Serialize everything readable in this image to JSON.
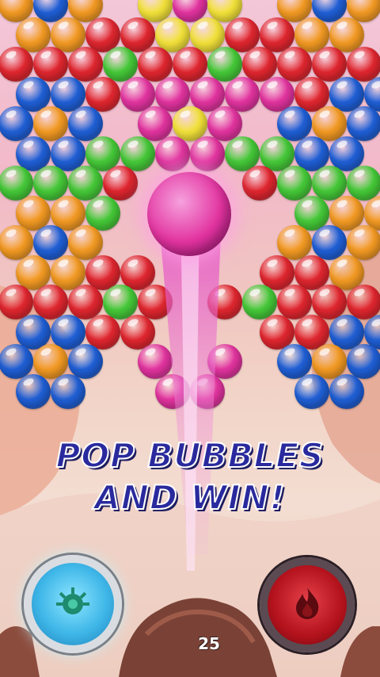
{
  "promo": {
    "line1": "POP BUBBLES",
    "line2": "AND WIN!"
  },
  "counter": {
    "shots_left": "25"
  },
  "buttons": {
    "booster": {
      "icon": "gear-bomb-icon",
      "color": "#3fb7e8"
    },
    "fire": {
      "icon": "flame-icon",
      "color": "#c21822"
    }
  },
  "shot_bubble": {
    "color": "magenta"
  },
  "palette": {
    "red": "#e0262f",
    "orange": "#f39a23",
    "blue": "#1f5fd6",
    "green": "#45c938",
    "yellow": "#f3e23a",
    "magenta": "#e2339f"
  },
  "grid": [
    [
      "orange",
      "blue",
      "orange",
      "",
      "yellow",
      "magenta",
      "yellow",
      "",
      "orange",
      "blue",
      "orange"
    ],
    [
      "orange",
      "orange",
      "red",
      "red",
      "yellow",
      "yellow",
      "red",
      "red",
      "orange",
      "orange",
      ""
    ],
    [
      "red",
      "red",
      "red",
      "green",
      "red",
      "red",
      "green",
      "red",
      "red",
      "red",
      "red"
    ],
    [
      "blue",
      "blue",
      "red",
      "magenta",
      "magenta",
      "magenta",
      "magenta",
      "magenta",
      "red",
      "blue",
      "blue"
    ],
    [
      "blue",
      "orange",
      "blue",
      "",
      "magenta",
      "yellow",
      "magenta",
      "",
      "blue",
      "orange",
      "blue"
    ],
    [
      "blue",
      "blue",
      "green",
      "green",
      "magenta",
      "magenta",
      "green",
      "green",
      "blue",
      "blue",
      ""
    ],
    [
      "green",
      "green",
      "green",
      "red",
      "",
      "",
      "",
      "red",
      "green",
      "green",
      "green"
    ],
    [
      "orange",
      "orange",
      "green",
      "",
      "",
      "",
      "",
      "",
      "green",
      "orange",
      "orange"
    ],
    [
      "orange",
      "blue",
      "orange",
      "",
      "",
      "",
      "",
      "",
      "orange",
      "blue",
      "orange"
    ],
    [
      "orange",
      "orange",
      "red",
      "red",
      "",
      "",
      "",
      "red",
      "red",
      "orange",
      ""
    ],
    [
      "red",
      "red",
      "red",
      "green",
      "red",
      "",
      "red",
      "green",
      "red",
      "red",
      "red"
    ],
    [
      "blue",
      "blue",
      "red",
      "red",
      "",
      "",
      "",
      "red",
      "red",
      "blue",
      "blue"
    ],
    [
      "blue",
      "orange",
      "blue",
      "",
      "magenta",
      "",
      "magenta",
      "",
      "blue",
      "orange",
      "blue"
    ],
    [
      "blue",
      "blue",
      "",
      "",
      "magenta",
      "magenta",
      "",
      "",
      "blue",
      "blue",
      ""
    ]
  ]
}
